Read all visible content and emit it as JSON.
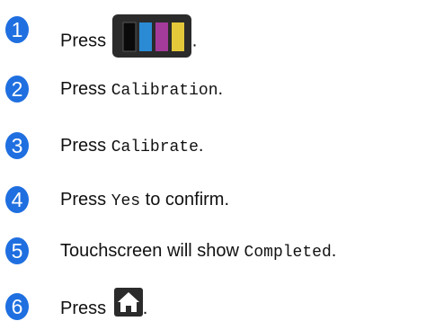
{
  "steps": [
    {
      "number": "1",
      "prefix": "Press",
      "suffix": "."
    },
    {
      "number": "2",
      "prefix": "Press",
      "code": "Calibration",
      "suffix": "."
    },
    {
      "number": "3",
      "prefix": "Press",
      "code": "Calibrate",
      "suffix": "."
    },
    {
      "number": "4",
      "prefix": "Press",
      "code": "Yes",
      "suffix": "to confirm."
    },
    {
      "number": "5",
      "prefix": "Touchscreen will show",
      "code": "Completed",
      "suffix": "."
    },
    {
      "number": "6",
      "prefix": "Press",
      "suffix": "."
    }
  ],
  "icons": {
    "ink_button": "ink-cartridges-icon",
    "home_button": "home-icon"
  },
  "colors": {
    "badge": "#1f6fe0",
    "ink_black": "#111111",
    "ink_cyan": "#2a8bd4",
    "ink_magenta": "#a43a9a",
    "ink_yellow": "#e3c93a",
    "icon_bg": "#2b2b2b"
  }
}
